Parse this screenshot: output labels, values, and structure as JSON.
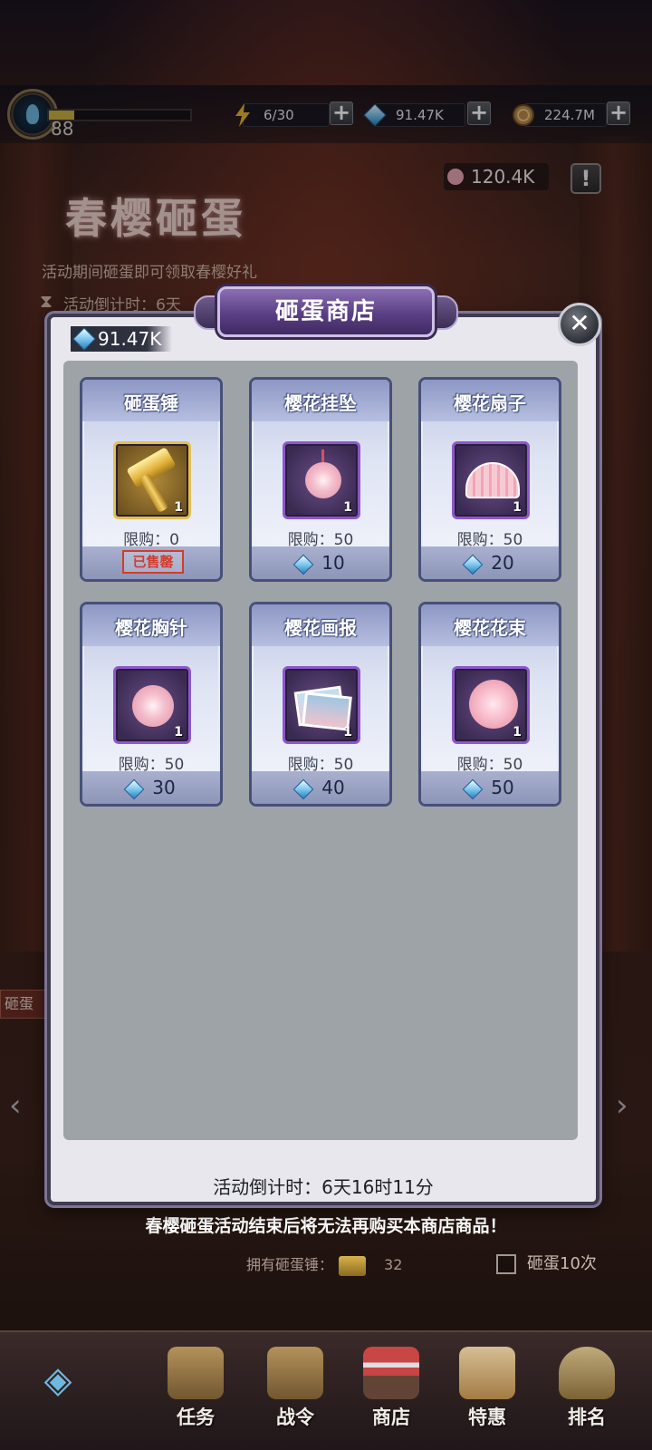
{
  "topbar": {
    "level": "88",
    "xp_fraction": 0.18,
    "energy": "6/30",
    "diamonds": "91.47K",
    "coins": "224.7M",
    "plus_label": "+"
  },
  "event": {
    "title": "春樱砸蛋",
    "description": "活动期间砸蛋即可领取春樱好礼",
    "countdown_partial": "活动倒计时：6天",
    "sakura_count": "120.4K",
    "info_label": "!",
    "side_tag": "砸蛋",
    "notice": "春樱砸蛋活动结束后将无法再购买本商店商品！",
    "own_hammer_label": "拥有砸蛋锤：",
    "own_hammer_count": "32",
    "smash10_label": "砸蛋10次"
  },
  "shop": {
    "title": "砸蛋商店",
    "close_label": "✕",
    "balance": "91.47K",
    "countdown": "活动倒计时：6天16时11分",
    "items": [
      {
        "name": "砸蛋锤",
        "qty": "1",
        "limit": "限购：0",
        "price": "",
        "sold_out": "已售罄",
        "icon": "gold-hammer-icon"
      },
      {
        "name": "樱花挂坠",
        "qty": "1",
        "limit": "限购：50",
        "price": "10",
        "icon": "sakura-pendant-icon"
      },
      {
        "name": "樱花扇子",
        "qty": "1",
        "limit": "限购：50",
        "price": "20",
        "icon": "sakura-fan-icon"
      },
      {
        "name": "樱花胸针",
        "qty": "1",
        "limit": "限购：50",
        "price": "30",
        "icon": "sakura-brooch-icon"
      },
      {
        "name": "樱花画报",
        "qty": "1",
        "limit": "限购：50",
        "price": "40",
        "icon": "sakura-poster-icon"
      },
      {
        "name": "樱花花束",
        "qty": "1",
        "limit": "限购：50",
        "price": "50",
        "icon": "sakura-bouquet-icon"
      }
    ]
  },
  "nav": {
    "items": [
      {
        "label": "任务",
        "icon": "scroll-icon"
      },
      {
        "label": "战令",
        "icon": "hammer-icon"
      },
      {
        "label": "商店",
        "icon": "shop-icon"
      },
      {
        "label": "特惠",
        "icon": "gift-icon"
      },
      {
        "label": "排名",
        "icon": "trophy-icon"
      }
    ]
  },
  "colors": {
    "dialog_bg": "#e9e7ee",
    "inner_bg": "#9ea3a7",
    "card_border": "#46507a",
    "title_purple": "#5b3f85",
    "sold_out_red": "#d33b2c"
  }
}
